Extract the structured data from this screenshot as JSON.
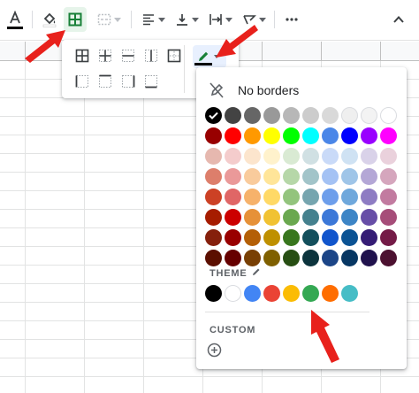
{
  "toolbar": {
    "icons": [
      "text-color-icon",
      "fill-color-icon",
      "borders-icon",
      "merge-cells-icon",
      "horizontal-align-icon",
      "vertical-align-icon",
      "text-wrapping-icon",
      "text-rotation-icon",
      "more-icon",
      "collapse-icon"
    ],
    "text_color_bar": "#000000"
  },
  "border_panel": {
    "buttons": [
      "all-borders-icon",
      "inner-borders-icon",
      "horizontal-borders-icon",
      "vertical-borders-icon",
      "outer-borders-icon",
      "left-border-icon",
      "top-border-icon",
      "right-border-icon",
      "bottom-border-icon"
    ],
    "border_color_icon": "pencil-icon",
    "border_color_value": "#000000"
  },
  "color_menu": {
    "no_borders_label": "No borders",
    "standard_rows": [
      [
        "#000000",
        "#434343",
        "#666666",
        "#999999",
        "#b7b7b7",
        "#cccccc",
        "#d9d9d9",
        "#efefef",
        "#f3f3f3",
        "#ffffff"
      ],
      [
        "#980000",
        "#ff0000",
        "#ff9900",
        "#ffff00",
        "#00ff00",
        "#00ffff",
        "#4a86e8",
        "#0000ff",
        "#9900ff",
        "#ff00ff"
      ],
      [
        "#e6b8af",
        "#f4cccc",
        "#fce5cd",
        "#fff2cc",
        "#d9ead3",
        "#d0e0e3",
        "#c9daf8",
        "#cfe2f3",
        "#d9d2e9",
        "#ead1dc"
      ],
      [
        "#dd7e6b",
        "#ea9999",
        "#f9cb9c",
        "#ffe599",
        "#b6d7a8",
        "#a2c4c9",
        "#a4c2f4",
        "#9fc5e8",
        "#b4a7d6",
        "#d5a6bd"
      ],
      [
        "#cc4125",
        "#e06666",
        "#f6b26b",
        "#ffd966",
        "#93c47d",
        "#76a5af",
        "#6d9eeb",
        "#6fa8dc",
        "#8e7cc3",
        "#c27ba0"
      ],
      [
        "#a61c00",
        "#cc0000",
        "#e69138",
        "#f1c232",
        "#6aa84f",
        "#45818e",
        "#3c78d8",
        "#3d85c6",
        "#674ea7",
        "#a64d79"
      ],
      [
        "#85200c",
        "#990000",
        "#b45f06",
        "#bf9000",
        "#38761d",
        "#134f5c",
        "#1155cc",
        "#0b5394",
        "#351c75",
        "#741b47"
      ],
      [
        "#5b0f00",
        "#660000",
        "#783f04",
        "#7f6000",
        "#274e13",
        "#0c343d",
        "#1c4587",
        "#073763",
        "#20124d",
        "#4c1130"
      ]
    ],
    "selected_color": "#000000",
    "theme_label": "THEME",
    "theme_colors": [
      "#000000",
      "#ffffff",
      "#4285f4",
      "#ea4335",
      "#fbbc04",
      "#34a853",
      "#ff6d01",
      "#46bdc6"
    ],
    "custom_label": "CUSTOM",
    "add_custom_icon": "add-circle-icon"
  },
  "annotation_color": "#e8211c"
}
